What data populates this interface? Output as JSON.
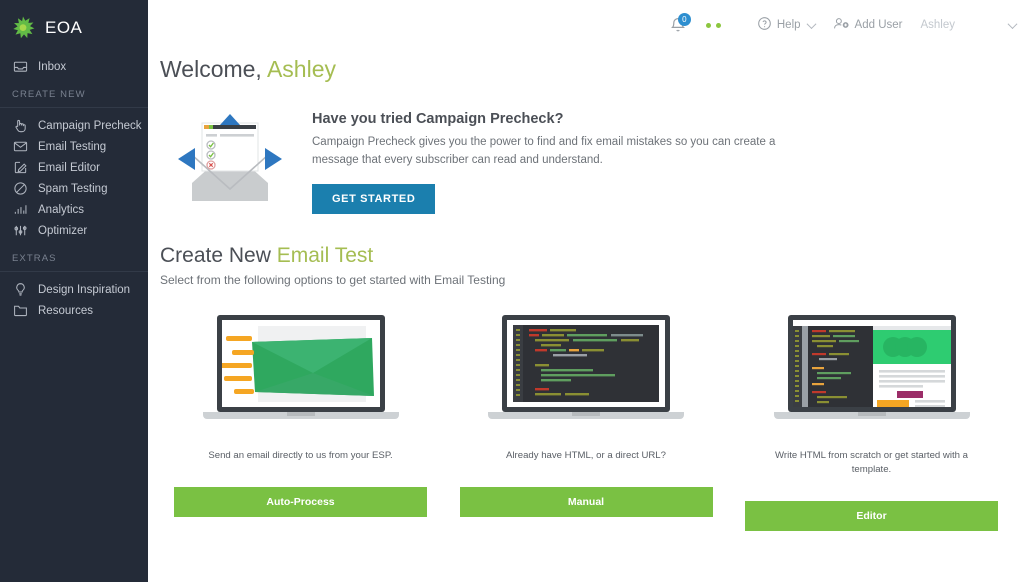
{
  "brand": {
    "name": "EOA",
    "logo_icon": "green-splat-logo",
    "accent_green": "#8cc63f",
    "accent_blue": "#1b7fae",
    "button_green": "#7ac143",
    "sidebar_bg": "#242b38"
  },
  "sidebar": {
    "top_items": [
      {
        "label": "Inbox",
        "icon": "inbox-icon"
      }
    ],
    "section_create_new": "CREATE NEW",
    "create_items": [
      {
        "label": "Campaign Precheck",
        "icon": "hand-cursor-icon"
      },
      {
        "label": "Email Testing",
        "icon": "envelope-icon"
      },
      {
        "label": "Email Editor",
        "icon": "pencil-square-icon"
      },
      {
        "label": "Spam Testing",
        "icon": "no-entry-icon"
      },
      {
        "label": "Analytics",
        "icon": "bar-chart-icon"
      },
      {
        "label": "Optimizer",
        "icon": "sliders-icon"
      }
    ],
    "section_extras": "EXTRAS",
    "extras_items": [
      {
        "label": "Design Inspiration",
        "icon": "lightbulb-icon"
      },
      {
        "label": "Resources",
        "icon": "folder-icon"
      }
    ]
  },
  "topbar": {
    "notification_icon": "bell-notification-icon",
    "notification_count": "0",
    "status_dots": "green-status-dots",
    "help_label": "Help",
    "help_icon": "question-circle-icon",
    "add_user_label": "Add User",
    "add_user_icon": "add-user-icon",
    "user_name": "Ashley",
    "chevron_icon": "chevron-down-icon"
  },
  "welcome": {
    "greeting": "Welcome,",
    "name": "Ashley"
  },
  "promo": {
    "illustration": "open-envelope-checklist-illustration",
    "title": "Have you tried Campaign Precheck?",
    "body": "Campaign Precheck gives you the power to find and fix email mistakes so you can create a message that every subscriber can read and understand.",
    "cta_label": "GET STARTED"
  },
  "create_new": {
    "title_prefix": "Create New",
    "title_accent": "Email Test",
    "subtitle": "Select from the following options to get started with Email Testing",
    "cards": [
      {
        "illustration": "laptop-envelope-speed-illustration",
        "caption": "Send an email directly to us from your ESP.",
        "button": "Auto-Process"
      },
      {
        "illustration": "laptop-code-editor-illustration",
        "caption": "Already have HTML, or a direct URL?",
        "button": "Manual"
      },
      {
        "illustration": "laptop-split-code-preview-illustration",
        "caption": "Write HTML from scratch or get started with a template.",
        "button": "Editor"
      }
    ]
  }
}
